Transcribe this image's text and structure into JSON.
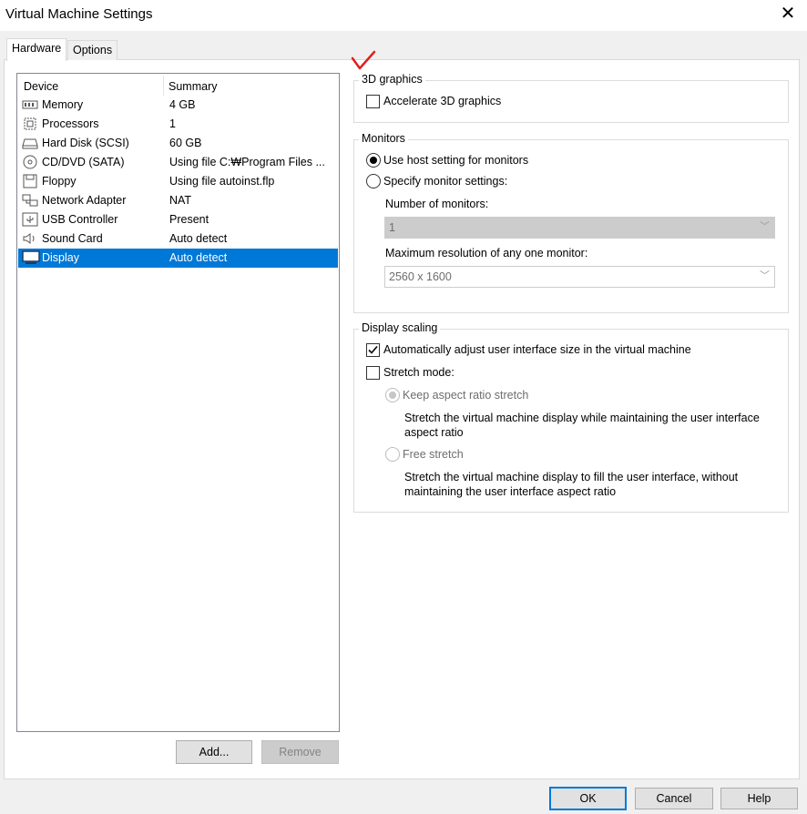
{
  "window": {
    "title": "Virtual Machine Settings",
    "close_glyph": "✕"
  },
  "tabs": [
    {
      "label": "Hardware"
    },
    {
      "label": "Options"
    }
  ],
  "device_list": {
    "headers": {
      "device": "Device",
      "summary": "Summary"
    },
    "rows": [
      {
        "device": "Memory",
        "summary": "4 GB",
        "icon": "memory-icon"
      },
      {
        "device": "Processors",
        "summary": "1",
        "icon": "processor-icon"
      },
      {
        "device": "Hard Disk (SCSI)",
        "summary": "60 GB",
        "icon": "hard-disk-icon"
      },
      {
        "device": "CD/DVD (SATA)",
        "summary": "Using file C:₩Program Files ...",
        "icon": "cd-dvd-icon"
      },
      {
        "device": "Floppy",
        "summary": "Using file autoinst.flp",
        "icon": "floppy-icon"
      },
      {
        "device": "Network Adapter",
        "summary": "NAT",
        "icon": "network-adapter-icon"
      },
      {
        "device": "USB Controller",
        "summary": "Present",
        "icon": "usb-icon"
      },
      {
        "device": "Sound Card",
        "summary": "Auto detect",
        "icon": "sound-icon"
      },
      {
        "device": "Display",
        "summary": "Auto detect",
        "icon": "display-icon",
        "selected": true
      }
    ]
  },
  "buttons": {
    "add": "Add...",
    "remove": "Remove",
    "ok": "OK",
    "cancel": "Cancel",
    "help": "Help"
  },
  "graphics_3d": {
    "label": "3D graphics",
    "accelerate": {
      "label": "Accelerate 3D graphics",
      "checked": false
    }
  },
  "monitors": {
    "label": "Monitors",
    "use_host": {
      "label": "Use host setting for monitors",
      "selected": true
    },
    "specify": {
      "label": "Specify monitor settings:",
      "selected": false
    },
    "number_label": "Number of monitors:",
    "number_value": "1",
    "max_res_label": "Maximum resolution of any one monitor:",
    "max_res_value": "2560 x 1600"
  },
  "display_scaling": {
    "label": "Display scaling",
    "auto_adjust": {
      "label": "Automatically adjust user interface size in the virtual machine",
      "checked": true
    },
    "stretch": {
      "label": "Stretch mode:",
      "checked": false
    },
    "keep_aspect": {
      "label": "Keep aspect ratio stretch",
      "desc_line1": "Stretch the virtual machine display while maintaining the user interface",
      "desc_line2": "aspect ratio"
    },
    "free_stretch": {
      "label": "Free stretch",
      "desc_line1": "Stretch the virtual machine display to fill the user interface, without",
      "desc_line2": "maintaining the user interface aspect ratio"
    }
  },
  "colors": {
    "selection": "#0078d7",
    "annotation": "#e0201b"
  }
}
